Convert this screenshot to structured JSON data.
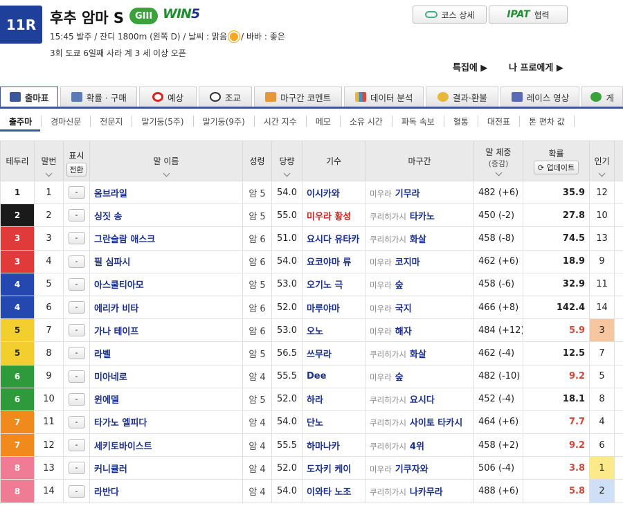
{
  "race": {
    "number": "11R",
    "name": "후추 암마 S",
    "grade": "GIII",
    "win5_a": "WIN",
    "win5_b": "5",
    "info_line1_a": "15:45 발주 / 잔디 1800m (왼쪽 D) / 날씨 : 맑음",
    "info_line1_b": "/ 바바 : 좋은",
    "info_line2": "3회 도쿄 6일째 사라 계 3 세 이상 오픈"
  },
  "buttons": {
    "course": "코스 상세",
    "ipat_logo": "IPAT",
    "ipat": "협력"
  },
  "links": {
    "special": "특집에 ▶",
    "pro": "나 프로에게 ▶"
  },
  "tabs": [
    {
      "label": "출마표",
      "icon": "racecard-icon"
    },
    {
      "label": "확률 · 구매",
      "icon": "odds-icon"
    },
    {
      "label": "예상",
      "icon": "target-icon"
    },
    {
      "label": "조교",
      "icon": "stopwatch-icon"
    },
    {
      "label": "마구간 코멘트",
      "icon": "stable-icon"
    },
    {
      "label": "데이터 분석",
      "icon": "chart-icon"
    },
    {
      "label": "결과·환불",
      "icon": "coins-icon"
    },
    {
      "label": "레이스 영상",
      "icon": "video-icon"
    },
    {
      "label": "게",
      "icon": "chat-icon"
    }
  ],
  "subtabs": [
    "출주마",
    "경마신문",
    "전문지",
    "말기둥(5주)",
    "말기둥(9주)",
    "시간 지수",
    "메모",
    "소유 시간",
    "파독 속보",
    "혈통",
    "대전표",
    "톤 편차 값"
  ],
  "headers": {
    "frame": "테두리",
    "number": "말번",
    "mark": "표시",
    "mark_switch": "전환",
    "horse": "말 이름",
    "sexage": "성령",
    "weight": "당량",
    "jockey": "기수",
    "trainer": "마구간",
    "body": "말 체중",
    "body_sub": "(증감)",
    "odds": "확률",
    "update": "업데이트",
    "pop": "인기"
  },
  "colors": {
    "frame": [
      "#ffffff",
      "#1a1a1a",
      "#e03a3a",
      "#e03a3a",
      "#2548b0",
      "#2548b0",
      "#f2cf2e",
      "#f2cf2e",
      "#2e9a3c",
      "#2e9a3c",
      "#f08a1d",
      "#f08a1d",
      "#f07b94",
      "#f07b94"
    ],
    "pop_highlight": {
      "1": "#fbe98a",
      "2": "#cfe0f6",
      "3": "#f5c6a0"
    }
  },
  "rows": [
    {
      "frame": "1",
      "num": "1",
      "mark": "-",
      "horse": "옴브라일",
      "sexage": "암 5",
      "weight": "54.0",
      "jockey": "이시카와",
      "region": "미우라",
      "trainer": "기무라",
      "body": "482 (+6)",
      "odds": "35.9",
      "pop": "12"
    },
    {
      "frame": "2",
      "num": "2",
      "mark": "-",
      "horse": "싱짓 송",
      "sexage": "암 5",
      "weight": "55.0",
      "jockey": "미우라 황성",
      "region": "쿠리히가시",
      "trainer": "타카노",
      "body": "450 (-2)",
      "odds": "27.8",
      "pop": "10"
    },
    {
      "frame": "3",
      "num": "3",
      "mark": "-",
      "horse": "그란슬람 애스크",
      "sexage": "암 6",
      "weight": "51.0",
      "jockey": "요시다 유타카",
      "region": "쿠리히가시",
      "trainer": "화살",
      "body": "458 (-8)",
      "odds": "74.5",
      "pop": "13"
    },
    {
      "frame": "3",
      "num": "4",
      "mark": "-",
      "horse": "필 심파시",
      "sexage": "암 6",
      "weight": "54.0",
      "jockey": "요코야마 류",
      "region": "미우라",
      "trainer": "코지마",
      "body": "462 (+6)",
      "odds": "18.9",
      "pop": "9"
    },
    {
      "frame": "4",
      "num": "5",
      "mark": "-",
      "horse": "아스쿨티아모",
      "sexage": "암 5",
      "weight": "53.0",
      "jockey": "오기노 극",
      "region": "미우라",
      "trainer": "숲",
      "body": "458 (-6)",
      "odds": "32.9",
      "pop": "11"
    },
    {
      "frame": "4",
      "num": "6",
      "mark": "-",
      "horse": "에리카 비타",
      "sexage": "암 6",
      "weight": "52.0",
      "jockey": "마루야마",
      "region": "미우라",
      "trainer": "국지",
      "body": "466 (+8)",
      "odds": "142.4",
      "pop": "14"
    },
    {
      "frame": "5",
      "num": "7",
      "mark": "-",
      "horse": "가나 테이프",
      "sexage": "암 6",
      "weight": "53.0",
      "jockey": "오노",
      "region": "미우라",
      "trainer": "해자",
      "body": "484 (+12)",
      "odds": "5.9",
      "pop": "3"
    },
    {
      "frame": "5",
      "num": "8",
      "mark": "-",
      "horse": "라벨",
      "sexage": "암 5",
      "weight": "56.5",
      "jockey": "쓰무라",
      "region": "쿠리히가시",
      "trainer": "화살",
      "body": "462 (-4)",
      "odds": "12.5",
      "pop": "7"
    },
    {
      "frame": "6",
      "num": "9",
      "mark": "-",
      "horse": "미아네로",
      "sexage": "암 4",
      "weight": "55.5",
      "jockey": "Dee",
      "region": "미우라",
      "trainer": "숲",
      "body": "482 (-10)",
      "odds": "9.2",
      "pop": "5"
    },
    {
      "frame": "6",
      "num": "10",
      "mark": "-",
      "horse": "윈에델",
      "sexage": "암 5",
      "weight": "52.0",
      "jockey": "하라",
      "region": "쿠리히가시",
      "trainer": "요시다",
      "body": "452 (-4)",
      "odds": "18.1",
      "pop": "8"
    },
    {
      "frame": "7",
      "num": "11",
      "mark": "-",
      "horse": "타가노 엘피다",
      "sexage": "암 4",
      "weight": "54.0",
      "jockey": "단노",
      "region": "쿠리히가시",
      "trainer": "사이토 타카시",
      "body": "464 (+6)",
      "odds": "7.7",
      "pop": "4"
    },
    {
      "frame": "7",
      "num": "12",
      "mark": "-",
      "horse": "세키토바이스트",
      "sexage": "암 4",
      "weight": "55.5",
      "jockey": "하마나카",
      "region": "쿠리히가시",
      "trainer": "4위",
      "body": "458 (+2)",
      "odds": "9.2",
      "pop": "6"
    },
    {
      "frame": "8",
      "num": "13",
      "mark": "-",
      "horse": "커니큘러",
      "sexage": "암 4",
      "weight": "52.0",
      "jockey": "도자키 케이",
      "region": "미우라",
      "trainer": "기쿠자와",
      "body": "506 (-4)",
      "odds": "3.8",
      "pop": "1"
    },
    {
      "frame": "8",
      "num": "14",
      "mark": "-",
      "horse": "라반다",
      "sexage": "암 4",
      "weight": "54.0",
      "jockey": "이와타 노조",
      "region": "쿠리히가시",
      "trainer": "나카무라",
      "body": "488 (+6)",
      "odds": "5.8",
      "pop": "2"
    }
  ]
}
